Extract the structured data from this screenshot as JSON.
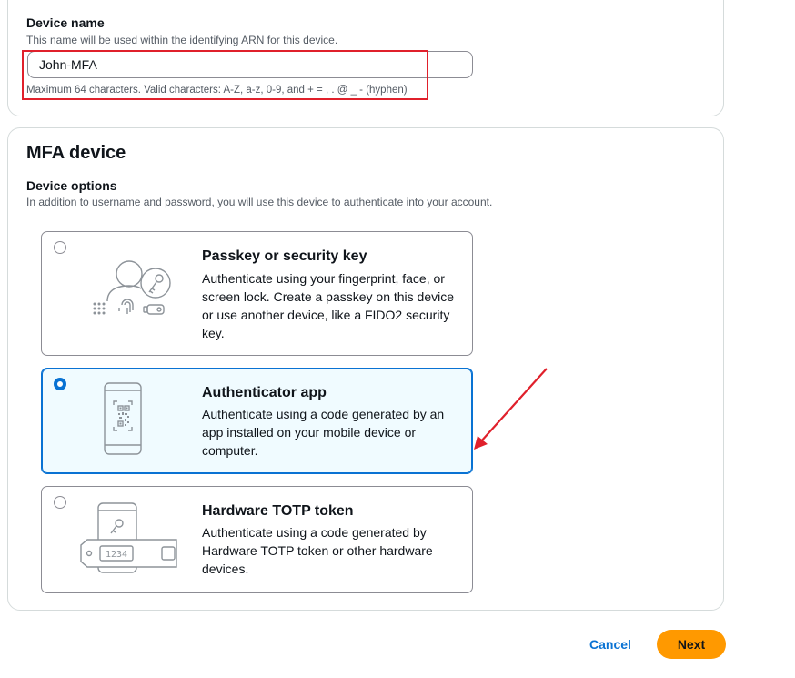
{
  "device_name": {
    "label": "Device name",
    "description": "This name will be used within the identifying ARN for this device.",
    "value": "John-MFA",
    "constraint": "Maximum 64 characters. Valid characters: A-Z, a-z, 0-9, and + = , . @ _ - (hyphen)"
  },
  "mfa_device": {
    "title": "MFA device",
    "options_label": "Device options",
    "options_description": "In addition to username and password, you will use this device to authenticate into your account.",
    "options": [
      {
        "title": "Passkey or security key",
        "description": "Authenticate using your fingerprint, face, or screen lock. Create a passkey on this device or use another device, like a FIDO2 security key.",
        "icon": "passkey-icon",
        "selected": false
      },
      {
        "title": "Authenticator app",
        "description": "Authenticate using a code generated by an app installed on your mobile device or computer.",
        "icon": "authenticator-app-icon",
        "selected": true
      },
      {
        "title": "Hardware TOTP token",
        "description": "Authenticate using a code generated by Hardware TOTP token or other hardware devices.",
        "icon": "hardware-token-icon",
        "selected": false,
        "token_display": "1234"
      }
    ]
  },
  "actions": {
    "cancel_label": "Cancel",
    "next_label": "Next"
  },
  "colors": {
    "accent": "#0972d3",
    "primary_button": "#ff9900",
    "annotation": "#e0202b"
  }
}
